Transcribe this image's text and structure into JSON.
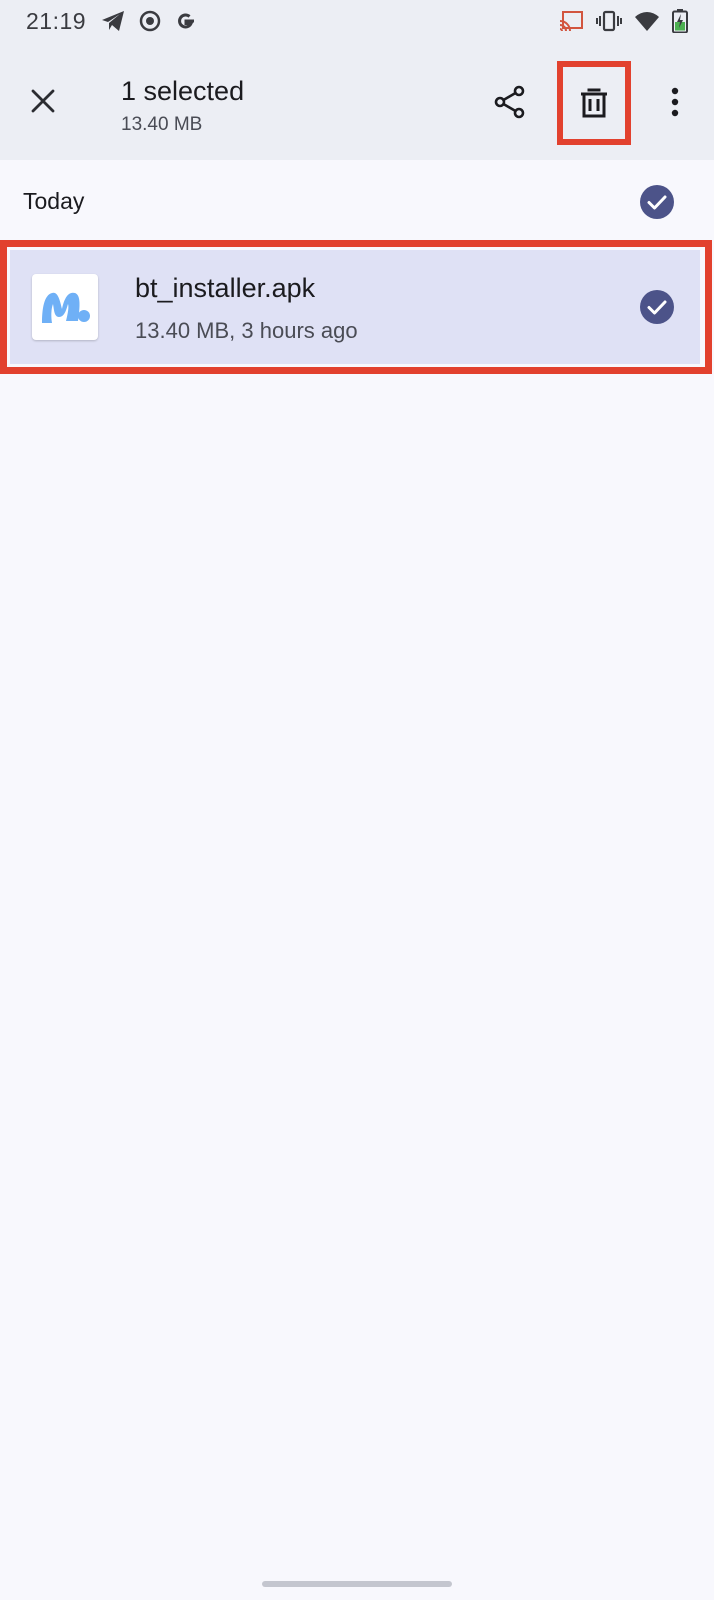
{
  "status_bar": {
    "time": "21:19",
    "left_icons": [
      "telegram-icon",
      "record-icon",
      "google-icon"
    ],
    "right_icons": [
      "cast-icon",
      "vibrate-icon",
      "wifi-icon",
      "battery-icon"
    ]
  },
  "app_bar": {
    "title": "1 selected",
    "subtitle": "13.40 MB",
    "actions": [
      "share-icon",
      "trash-icon",
      "more-vertical-icon"
    ]
  },
  "section": {
    "title": "Today",
    "selected": true
  },
  "files": [
    {
      "name": "bt_installer.apk",
      "meta": "13.40 MB, 3 hours ago",
      "selected": true,
      "thumbnail_icon": "app-logo-icon"
    }
  ],
  "colors": {
    "app_bar_bg": "#eceef4",
    "page_bg": "#f8f8fd",
    "selected_row_bg": "#dfe1f5",
    "check_circle": "#4c5389",
    "highlight_outline": "#e2412e",
    "logo_blue": "#6fb0f6"
  }
}
